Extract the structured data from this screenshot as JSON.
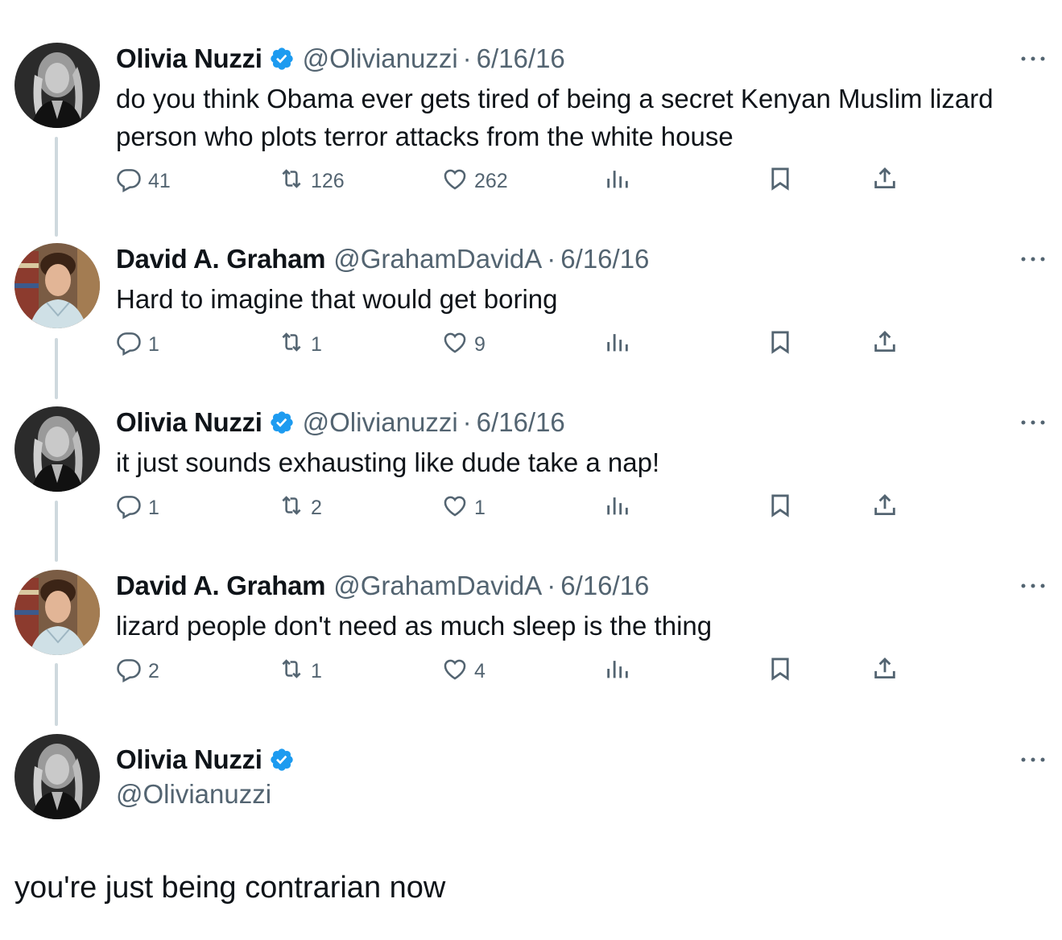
{
  "tweets": [
    {
      "name": "Olivia Nuzzi",
      "verified": true,
      "handle": "@Olivianuzzi",
      "dot": "·",
      "date": "6/16/16",
      "text": "do you think Obama ever gets tired of being a secret Kenyan Muslim lizard person who plots terror attacks from the white house",
      "replies": "41",
      "reposts": "126",
      "likes": "262"
    },
    {
      "name": "David A. Graham",
      "verified": false,
      "handle": "@GrahamDavidA",
      "dot": "·",
      "date": "6/16/16",
      "text": "Hard to imagine that would get boring",
      "replies": "1",
      "reposts": "1",
      "likes": "9"
    },
    {
      "name": "Olivia Nuzzi",
      "verified": true,
      "handle": "@Olivianuzzi",
      "dot": "·",
      "date": "6/16/16",
      "text": "it just sounds exhausting like dude take a nap!",
      "replies": "1",
      "reposts": "2",
      "likes": "1"
    },
    {
      "name": "David A. Graham",
      "verified": false,
      "handle": "@GrahamDavidA",
      "dot": "·",
      "date": "6/16/16",
      "text": "lizard people don't need as much sleep is the thing",
      "replies": "2",
      "reposts": "1",
      "likes": "4"
    }
  ],
  "focused": {
    "name": "Olivia Nuzzi",
    "verified": true,
    "handle": "@Olivianuzzi",
    "text": "you're just being contrarian now"
  },
  "colors": {
    "text": "#0f1419",
    "secondary": "#536471",
    "verified": "#1d9bf0",
    "thread_line": "#cfd9de"
  },
  "icons": {
    "reply": "reply-icon",
    "repost": "repost-icon",
    "like": "like-icon",
    "views": "views-icon",
    "bookmark": "bookmark-icon",
    "share": "share-icon",
    "more": "more-icon",
    "verified": "verified-badge-icon"
  }
}
